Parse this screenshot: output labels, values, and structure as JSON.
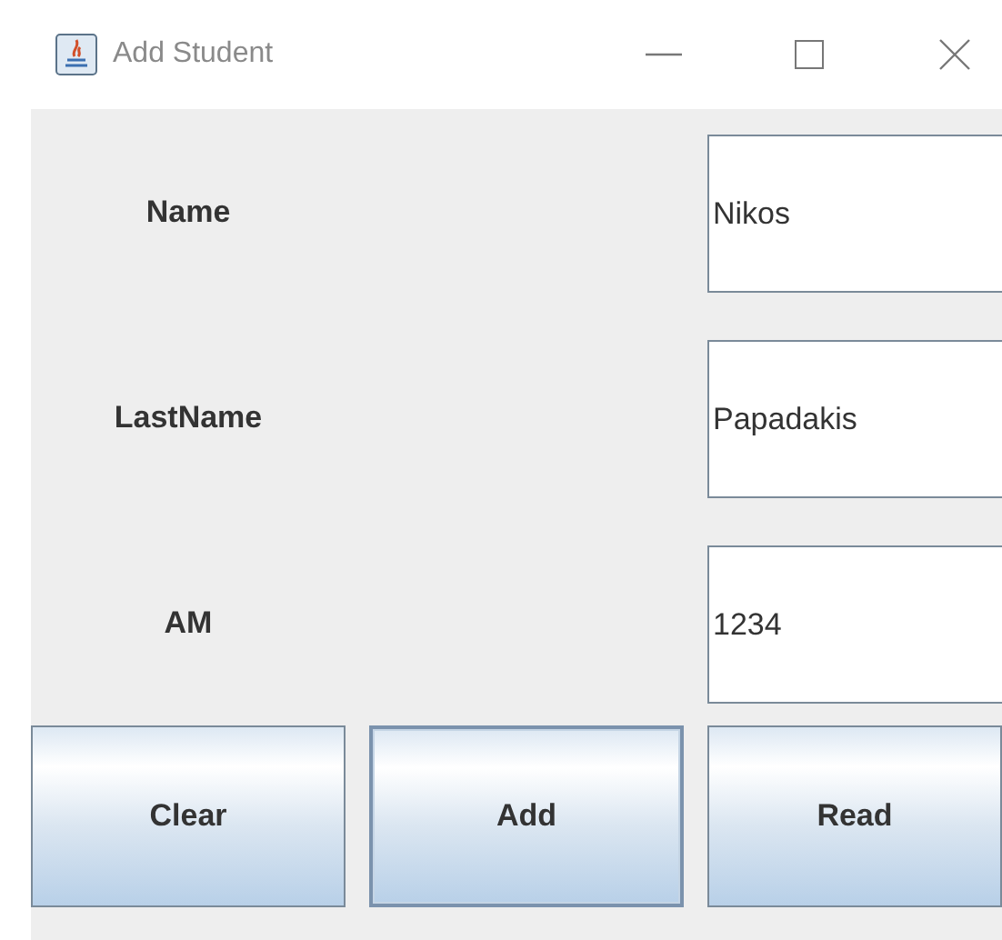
{
  "window": {
    "title": "Add Student"
  },
  "fields": [
    {
      "label": "Name",
      "value": "Nikos"
    },
    {
      "label": "LastName",
      "value": "Papadakis"
    },
    {
      "label": "AM",
      "value": "1234"
    }
  ],
  "buttons": [
    {
      "label": "Clear",
      "focused": false
    },
    {
      "label": "Add",
      "focused": true
    },
    {
      "label": "Read",
      "focused": false
    }
  ]
}
